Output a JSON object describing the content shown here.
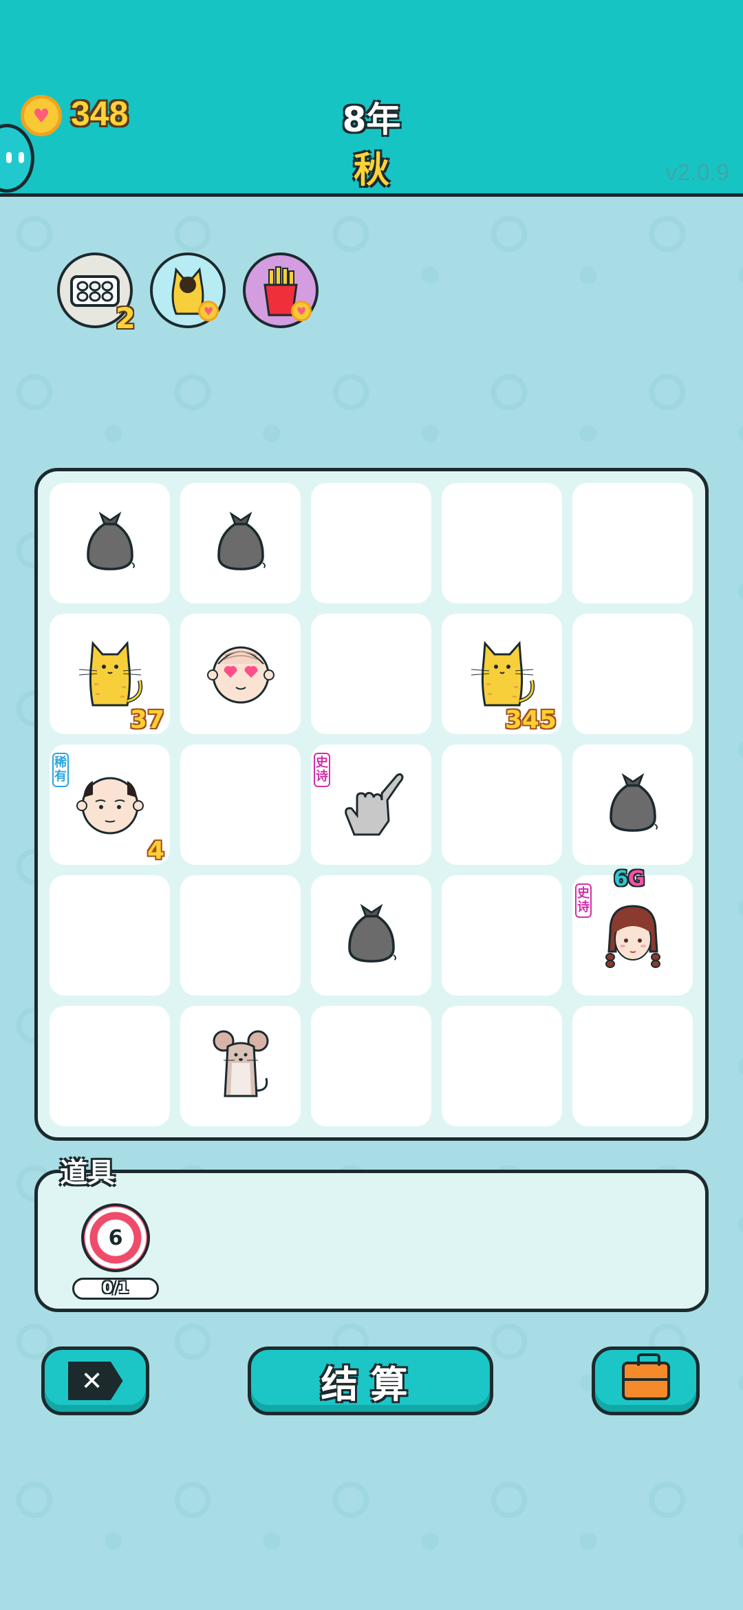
{
  "header": {
    "coins": "348",
    "year": "8年",
    "season": "秋",
    "version": "v2.0.9"
  },
  "effects": [
    {
      "name": "egg-carton",
      "count": "2",
      "bg": "#e7e7df"
    },
    {
      "name": "cat-coin",
      "count": "",
      "bg": "#b7ecf4"
    },
    {
      "name": "fries-coin",
      "count": "",
      "bg": "#d39de0"
    }
  ],
  "board": {
    "cells": [
      {
        "symbol": "garbage-bag",
        "value": "",
        "tag": ""
      },
      {
        "symbol": "garbage-bag",
        "value": "",
        "tag": ""
      },
      {
        "symbol": "empty",
        "value": "",
        "tag": ""
      },
      {
        "symbol": "empty",
        "value": "",
        "tag": ""
      },
      {
        "symbol": "empty",
        "value": "",
        "tag": ""
      },
      {
        "symbol": "cat",
        "value": "37",
        "tag": ""
      },
      {
        "symbol": "old-man-love-eyes",
        "value": "",
        "tag": ""
      },
      {
        "symbol": "empty",
        "value": "",
        "tag": ""
      },
      {
        "symbol": "cat",
        "value": "345",
        "tag": ""
      },
      {
        "symbol": "empty",
        "value": "",
        "tag": ""
      },
      {
        "symbol": "bald-man",
        "value": "4",
        "tag": "稀有"
      },
      {
        "symbol": "empty",
        "value": "",
        "tag": ""
      },
      {
        "symbol": "pointing-hand",
        "value": "",
        "tag": "史诗"
      },
      {
        "symbol": "empty",
        "value": "",
        "tag": ""
      },
      {
        "symbol": "garbage-bag",
        "value": "",
        "tag": ""
      },
      {
        "symbol": "empty",
        "value": "",
        "tag": ""
      },
      {
        "symbol": "empty",
        "value": "",
        "tag": ""
      },
      {
        "symbol": "garbage-bag",
        "value": "",
        "tag": ""
      },
      {
        "symbol": "empty",
        "value": "",
        "tag": ""
      },
      {
        "symbol": "girl",
        "value": "",
        "tag": "史诗",
        "top_value": "6",
        "top_suffix": "G"
      },
      {
        "symbol": "empty",
        "value": "",
        "tag": ""
      },
      {
        "symbol": "mouse",
        "value": "",
        "tag": ""
      },
      {
        "symbol": "empty",
        "value": "",
        "tag": ""
      },
      {
        "symbol": "empty",
        "value": "",
        "tag": ""
      },
      {
        "symbol": "empty",
        "value": "",
        "tag": ""
      }
    ]
  },
  "items": {
    "title": "道具",
    "slot": {
      "icon": "target-icon",
      "number": "6",
      "progress": "0/1"
    }
  },
  "buttons": {
    "close_icon": "close-tag-icon",
    "settle_label": "结算",
    "bag_icon": "briefcase-icon"
  },
  "colors": {
    "header": "#17c4c4",
    "background": "#a9dde6",
    "coin": "#ffd338",
    "rare": "#2aa6e0",
    "epic": "#d12fa8"
  }
}
